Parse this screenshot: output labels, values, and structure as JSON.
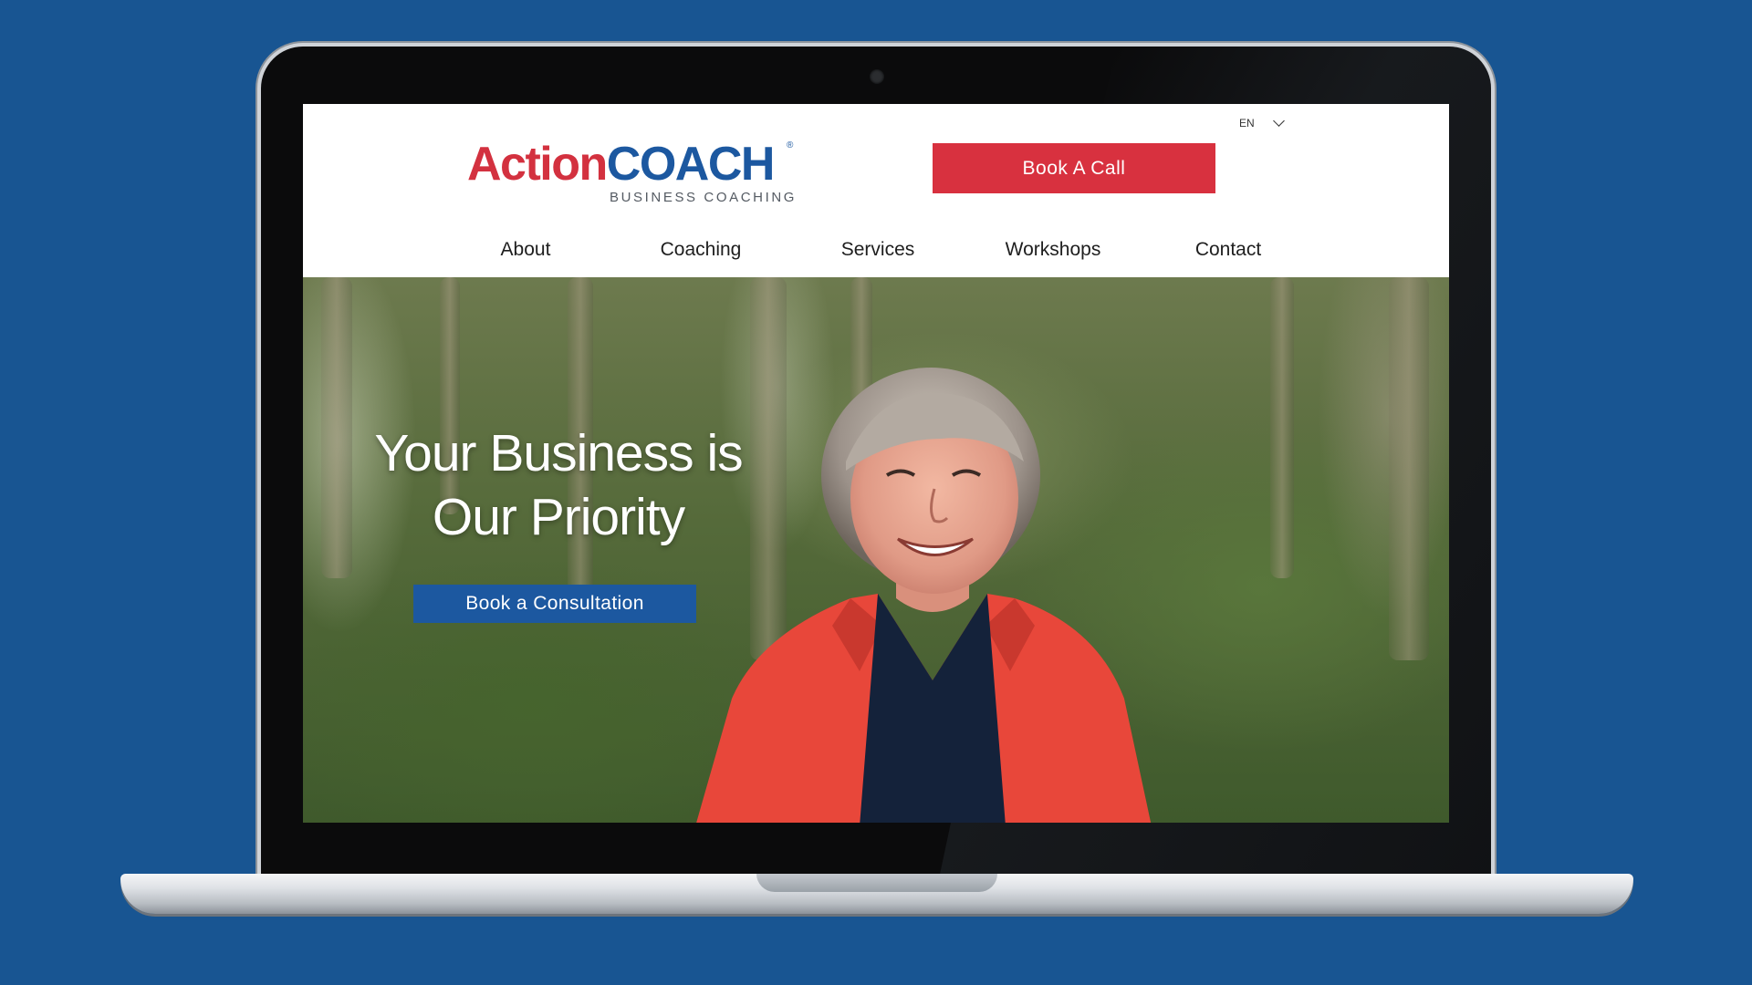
{
  "colors": {
    "background": "#185592",
    "brand_red": "#d8313f",
    "brand_blue": "#1c58a0"
  },
  "logo": {
    "action": "Action",
    "coach": "COACH",
    "registered": "®",
    "subtitle": "BUSINESS COACHING"
  },
  "language": {
    "selected": "EN",
    "icon": "chevron-down-icon"
  },
  "header": {
    "cta_label": "Book A Call"
  },
  "nav": {
    "items": [
      {
        "label": "About"
      },
      {
        "label": "Coaching"
      },
      {
        "label": "Services"
      },
      {
        "label": "Workshops"
      },
      {
        "label": "Contact"
      }
    ]
  },
  "hero": {
    "title_line1": "Your Business is",
    "title_line2": "Our Priority",
    "cta_label": "Book a Consultation"
  }
}
